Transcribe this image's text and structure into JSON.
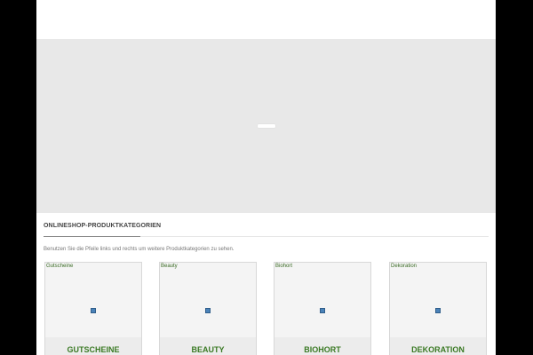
{
  "colors": {
    "accent_green": "#3b7a25",
    "slider_bg": "#e8e8e8",
    "outer_bg": "#000000"
  },
  "slider": {
    "loader_icon": "loading-bar-icon"
  },
  "section": {
    "title": "ONLINESHOP-PRODUKTKATEGORIEN",
    "intro": "Benutzen Sie die Pfeile links und rechts um weitere Produktkategorien zu sehen."
  },
  "categories": [
    {
      "alt": "Gutscheine",
      "name": "GUTSCHEINE",
      "icon": "broken-image-icon"
    },
    {
      "alt": "Beauty",
      "name": "BEAUTY",
      "icon": "broken-image-icon"
    },
    {
      "alt": "Biohort",
      "name": "BIOHORT",
      "icon": "broken-image-icon"
    },
    {
      "alt": "Dekoration",
      "name": "DEKORATION",
      "icon": "broken-image-icon"
    }
  ]
}
